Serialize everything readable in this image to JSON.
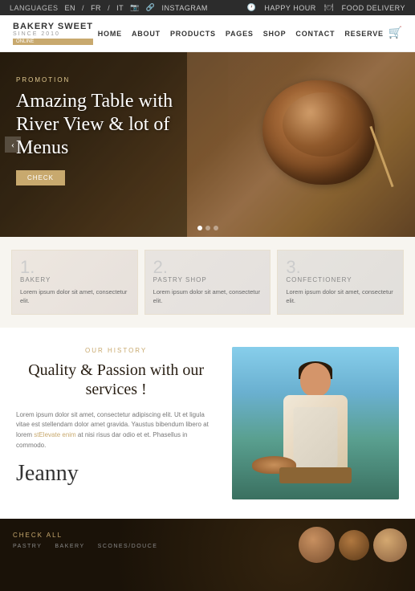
{
  "topbar": {
    "languages_label": "LANGUAGES",
    "lang_en": "EN",
    "lang_fr": "FR",
    "lang_it": "IT",
    "instagram": "INSTAGRAM",
    "happy_hour": "HAPPY HOUR",
    "food_delivery": "FOOD DELIVERY"
  },
  "navbar": {
    "logo_title": "BAKERY SWEET",
    "logo_subtitle": "SINCE 2010",
    "logo_badge": "ONLINE",
    "nav_home": "HOME",
    "nav_about": "ABOUT",
    "nav_products": "PRODUCTS",
    "nav_pages": "PAGES",
    "nav_shop": "SHOP",
    "nav_contact": "CONTACT",
    "nav_reserve": "RESERVE"
  },
  "hero": {
    "promotion": "PROMOTION",
    "title": "Amazing Table with River View & lot of Menus",
    "button": "CHECK"
  },
  "services": [
    {
      "num": "1.",
      "name": "Bakery",
      "desc": "Lorem ipsum dolor sit amet, consectetur elit."
    },
    {
      "num": "2.",
      "name": "Pastry Shop",
      "desc": "Lorem ipsum dolor sit amet, consectetur elit."
    },
    {
      "num": "3.",
      "name": "Confectionery",
      "desc": "Lorem ipsum dolor sit amet, consectetur elit."
    }
  ],
  "history": {
    "label": "OUR HISTORY",
    "title": "Quality & Passion with our services !",
    "body1": "Lorem ipsum dolor sit amet, consectetur adipiscing elit. Ut et ligula vitae est stellendam dolor amet gravida. Yaustus bibendum libero at lorem ",
    "body_link": "stElevate enim",
    "body2": " at nisi risus dar odio et et. Phasellus in commodo.",
    "signature": "Jeanny"
  },
  "footer": {
    "check_all": "CHECK ALL",
    "categories": [
      "PASTRY",
      "BAKERY",
      "SCONES/DOUCE"
    ]
  }
}
